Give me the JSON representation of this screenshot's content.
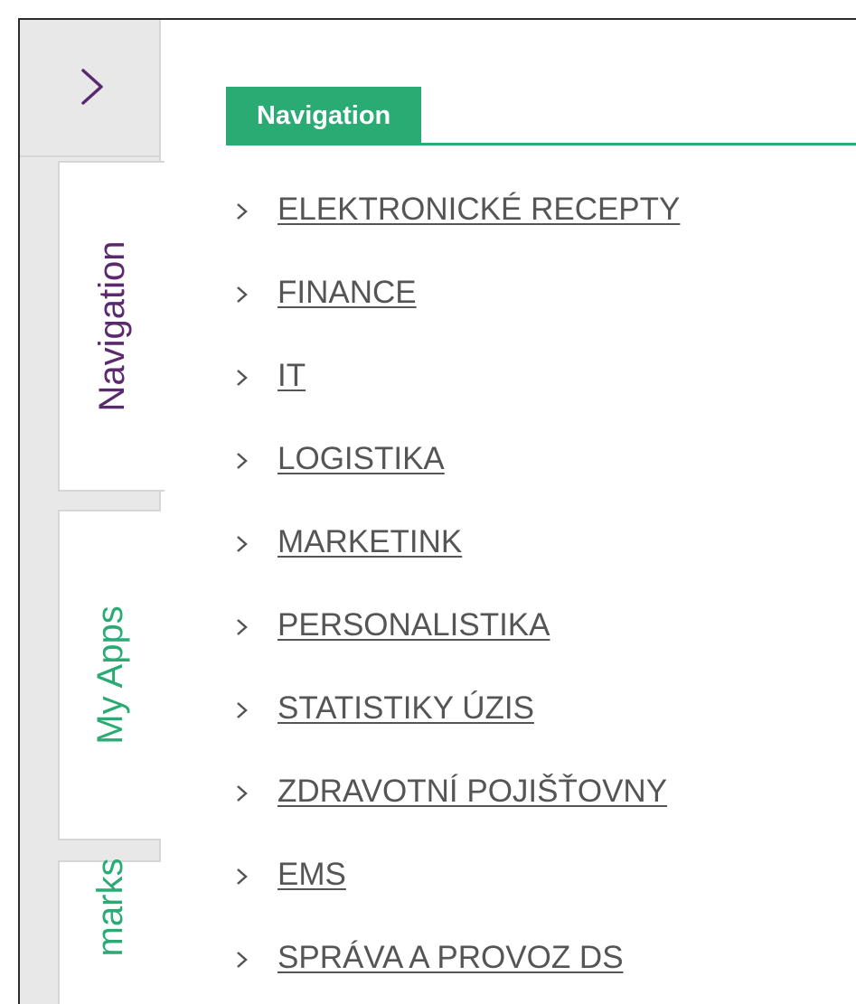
{
  "rail": {
    "collapse_icon": "chevron-right-icon",
    "tabs": [
      {
        "label": "Navigation",
        "active": true,
        "color": "#5b2a6e"
      },
      {
        "label": "My Apps",
        "active": false,
        "color": "#2bab74"
      },
      {
        "label": "marks",
        "active": false,
        "color": "#2bab74"
      }
    ]
  },
  "panel": {
    "title": "Navigation",
    "accent_color": "#2bab74",
    "items": [
      {
        "label": "ELEKTRONICKÉ RECEPTY"
      },
      {
        "label": "FINANCE"
      },
      {
        "label": "IT"
      },
      {
        "label": "LOGISTIKA"
      },
      {
        "label": "MARKETINK"
      },
      {
        "label": "PERSONALISTIKA"
      },
      {
        "label": "STATISTIKY ÚZIS"
      },
      {
        "label": "ZDRAVOTNÍ POJIŠŤOVNY"
      },
      {
        "label": "EMS"
      },
      {
        "label": "SPRÁVA A PROVOZ DS"
      }
    ]
  }
}
